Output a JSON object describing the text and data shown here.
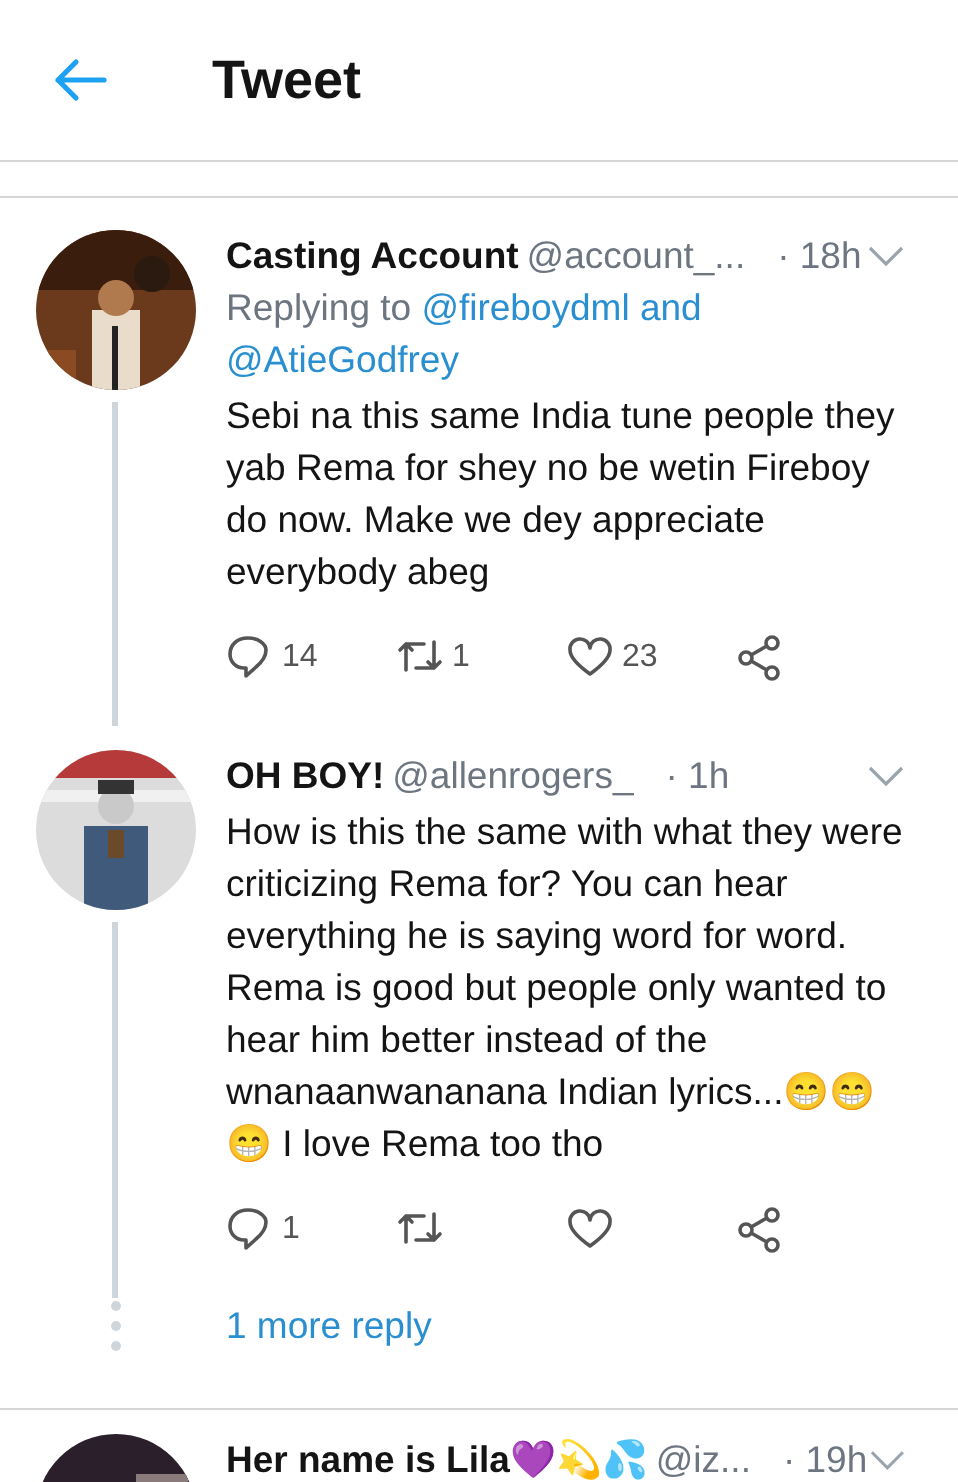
{
  "header": {
    "title": "Tweet"
  },
  "tweets": [
    {
      "name": "Casting Account",
      "handle": "@account_...",
      "time": "· 18h",
      "reply_prefix": "Replying to",
      "reply_targets": [
        "@fireboydml",
        "and",
        "@AtieGodfrey"
      ],
      "text": "Sebi na this same India tune people they yab Rema for shey no be wetin Fireboy do now. Make we dey appreciate everybody abeg",
      "actions": {
        "replies": "14",
        "retweets": "1",
        "likes": "23"
      },
      "thread_below": true
    },
    {
      "name": "OH BOY!",
      "handle": "@allenrogers_",
      "time": "· 1h",
      "text": "How is this the same with what they were criticizing Rema for? You can hear everything he is saying word for word. Rema is good but people only wanted to hear him better instead of the wnanaanwananana Indian lyrics...😁😁 😁 I love Rema too tho",
      "actions": {
        "replies": "1"
      },
      "thread_below": true,
      "more_replies": "1 more reply"
    },
    {
      "name": "Her name is Lila💜💫💦",
      "handle": "@iz...",
      "time": "· 19h",
      "thread_below": false
    }
  ]
}
